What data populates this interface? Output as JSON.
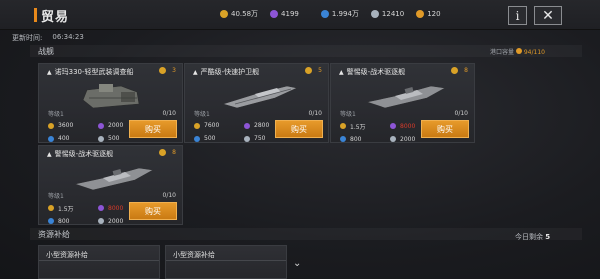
{
  "header": {
    "title": "贸易",
    "info_label": "i",
    "close_label": "✕"
  },
  "currencies": [
    {
      "icon": "gold-coin-icon",
      "value": "40.58万",
      "color": "#d9a227"
    },
    {
      "icon": "crystal-icon",
      "value": "4199",
      "color": "#8d55d6"
    },
    {
      "icon": "energy-icon",
      "value": "1.994万",
      "color": "#3a84d6"
    },
    {
      "icon": "alloy-icon",
      "value": "12410",
      "color": "#a8b2bd"
    },
    {
      "icon": "token-icon",
      "value": "120",
      "color": "#e09a28"
    }
  ],
  "timer": {
    "label": "更新时间:",
    "value": "06:34:23"
  },
  "sections": {
    "warships": {
      "title": "战舰",
      "capacity_label": "港口容量",
      "capacity_value": "94/110"
    },
    "resources": {
      "title": "资源补给",
      "today_label": "今日剩余",
      "today_value": "5"
    }
  },
  "cards": [
    {
      "name": "诺玛330-轻型武装调查船",
      "slot_value": "3",
      "level": "等级1",
      "stock": "0/10",
      "costs": [
        {
          "icon": "gold-coin-icon",
          "value": "3600",
          "warn": false
        },
        {
          "icon": "crystal-icon",
          "value": "2000",
          "warn": false
        },
        {
          "icon": "energy-icon",
          "value": "400",
          "warn": false
        },
        {
          "icon": "alloy-icon",
          "value": "500",
          "warn": false
        }
      ],
      "buy_label": "购买"
    },
    {
      "name": "严酷级-快速护卫舰",
      "slot_value": "5",
      "level": "等级1",
      "stock": "0/10",
      "costs": [
        {
          "icon": "gold-coin-icon",
          "value": "7600",
          "warn": false
        },
        {
          "icon": "crystal-icon",
          "value": "2800",
          "warn": false
        },
        {
          "icon": "energy-icon",
          "value": "500",
          "warn": false
        },
        {
          "icon": "alloy-icon",
          "value": "750",
          "warn": false
        }
      ],
      "buy_label": "购买"
    },
    {
      "name": "警惕级-战术驱逐舰",
      "slot_value": "8",
      "level": "等级1",
      "stock": "0/10",
      "costs": [
        {
          "icon": "gold-coin-icon",
          "value": "1.5万",
          "warn": false
        },
        {
          "icon": "crystal-icon",
          "value": "8000",
          "warn": true
        },
        {
          "icon": "energy-icon",
          "value": "800",
          "warn": false
        },
        {
          "icon": "alloy-icon",
          "value": "2000",
          "warn": false
        }
      ],
      "buy_label": "购买"
    },
    {
      "name": "警惕级-战术驱逐舰",
      "slot_value": "8",
      "level": "等级1",
      "stock": "0/10",
      "costs": [
        {
          "icon": "gold-coin-icon",
          "value": "1.5万",
          "warn": false
        },
        {
          "icon": "crystal-icon",
          "value": "8000",
          "warn": true
        },
        {
          "icon": "energy-icon",
          "value": "800",
          "warn": false
        },
        {
          "icon": "alloy-icon",
          "value": "2000",
          "warn": false
        }
      ],
      "buy_label": "购买"
    }
  ],
  "supply_cards": [
    {
      "name": "小型资源补给"
    },
    {
      "name": "小型资源补给"
    }
  ],
  "scroll_hint": "⌄"
}
